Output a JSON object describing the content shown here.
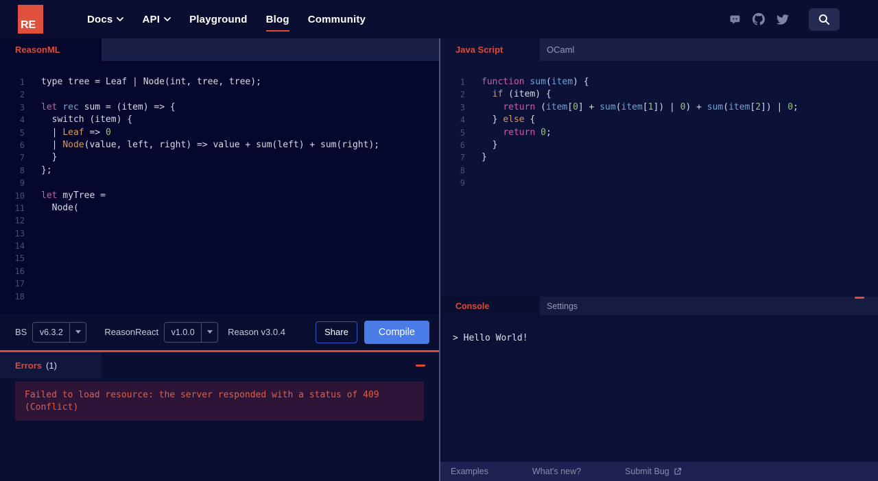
{
  "nav": {
    "logo_text": "RE",
    "items": [
      {
        "label": "Docs",
        "chevron": true
      },
      {
        "label": "API",
        "chevron": true
      },
      {
        "label": "Playground",
        "chevron": false
      },
      {
        "label": "Blog",
        "chevron": false,
        "active": true
      },
      {
        "label": "Community",
        "chevron": false
      }
    ],
    "social_icons": [
      "discord-icon",
      "github-icon",
      "twitter-icon"
    ],
    "search_icon": "search-icon"
  },
  "left_editor": {
    "tab_label": "ReasonML",
    "line_count": 18,
    "lines": [
      [
        [
          "p",
          "type tree = Leaf | Node(int, tree, tree);"
        ]
      ],
      [],
      [
        [
          "k",
          "let"
        ],
        [
          "p",
          " "
        ],
        [
          "b",
          "rec"
        ],
        [
          "p",
          " sum = (item) => {"
        ]
      ],
      [
        [
          "p",
          "  switch (item) {"
        ]
      ],
      [
        [
          "p",
          "  | "
        ],
        [
          "o",
          "Leaf"
        ],
        [
          "p",
          " => "
        ],
        [
          "g",
          "0"
        ]
      ],
      [
        [
          "p",
          "  | "
        ],
        [
          "o",
          "Node"
        ],
        [
          "p",
          "(value, left, right) => value + sum(left) + sum(right);"
        ]
      ],
      [
        [
          "p",
          "  }"
        ]
      ],
      [
        [
          "p",
          "};"
        ]
      ],
      [],
      [
        [
          "k",
          "let"
        ],
        [
          "p",
          " myTree ="
        ]
      ],
      [
        [
          "p",
          "  Node("
        ]
      ],
      [],
      [],
      [],
      [],
      [],
      [],
      []
    ]
  },
  "right_editor": {
    "tabs": [
      "Java Script",
      "OCaml"
    ],
    "active_tab": "Java Script",
    "line_count": 9,
    "lines": [
      [
        [
          "k",
          "function"
        ],
        [
          "p",
          " "
        ],
        [
          "b",
          "sum"
        ],
        [
          "p",
          "("
        ],
        [
          "b",
          "item"
        ],
        [
          "p",
          ") {"
        ]
      ],
      [
        [
          "p",
          "  "
        ],
        [
          "o",
          "if"
        ],
        [
          "p",
          " (item) {"
        ]
      ],
      [
        [
          "p",
          "    "
        ],
        [
          "k",
          "return"
        ],
        [
          "p",
          " ("
        ],
        [
          "b",
          "item"
        ],
        [
          "p",
          "["
        ],
        [
          "g",
          "0"
        ],
        [
          "p",
          "] + "
        ],
        [
          "b",
          "sum"
        ],
        [
          "p",
          "("
        ],
        [
          "b",
          "item"
        ],
        [
          "p",
          "["
        ],
        [
          "g",
          "1"
        ],
        [
          "p",
          "]) | "
        ],
        [
          "g",
          "0"
        ],
        [
          "p",
          ") + "
        ],
        [
          "b",
          "sum"
        ],
        [
          "p",
          "("
        ],
        [
          "b",
          "item"
        ],
        [
          "p",
          "["
        ],
        [
          "g",
          "2"
        ],
        [
          "p",
          "]) | "
        ],
        [
          "g",
          "0"
        ],
        [
          "p",
          ";"
        ]
      ],
      [
        [
          "p",
          "  } "
        ],
        [
          "o",
          "else"
        ],
        [
          "p",
          " {"
        ]
      ],
      [
        [
          "p",
          "    "
        ],
        [
          "k",
          "return"
        ],
        [
          "p",
          " "
        ],
        [
          "g",
          "0"
        ],
        [
          "p",
          ";"
        ]
      ],
      [
        [
          "p",
          "  }"
        ]
      ],
      [
        [
          "p",
          "}"
        ]
      ],
      [],
      []
    ]
  },
  "toolbar": {
    "bs_label": "BS",
    "bs_version": "v6.3.2",
    "reasonreact_label": "ReasonReact",
    "reasonreact_version": "v1.0.0",
    "reason_version": "Reason v3.0.4",
    "share_label": "Share",
    "compile_label": "Compile"
  },
  "errors": {
    "title": "Errors",
    "count": "(1)",
    "message": "Failed to load resource: the server responded with a status of 409 (Conflict)"
  },
  "console": {
    "tabs": [
      "Console",
      "Settings"
    ],
    "active_tab": "Console",
    "output": "> Hello World!"
  },
  "footer": {
    "items": [
      "Examples",
      "What's new?",
      "Submit Bug"
    ]
  },
  "colors": {
    "accent": "#dd4b39",
    "page_bg": "#0a0e31",
    "left_editor_bg": "#05082c",
    "right_editor_bg": "#0c1138",
    "compile_button": "#4a7ce8",
    "share_border": "#2f56c4",
    "error_box_bg": "#2e1537",
    "error_text": "#dd5f47",
    "code_keyword": "#c75fae",
    "code_identifier": "#6ea3d0",
    "code_number": "#98c379",
    "code_variant": "#d19a66",
    "logo_bg": "#e0513d"
  }
}
